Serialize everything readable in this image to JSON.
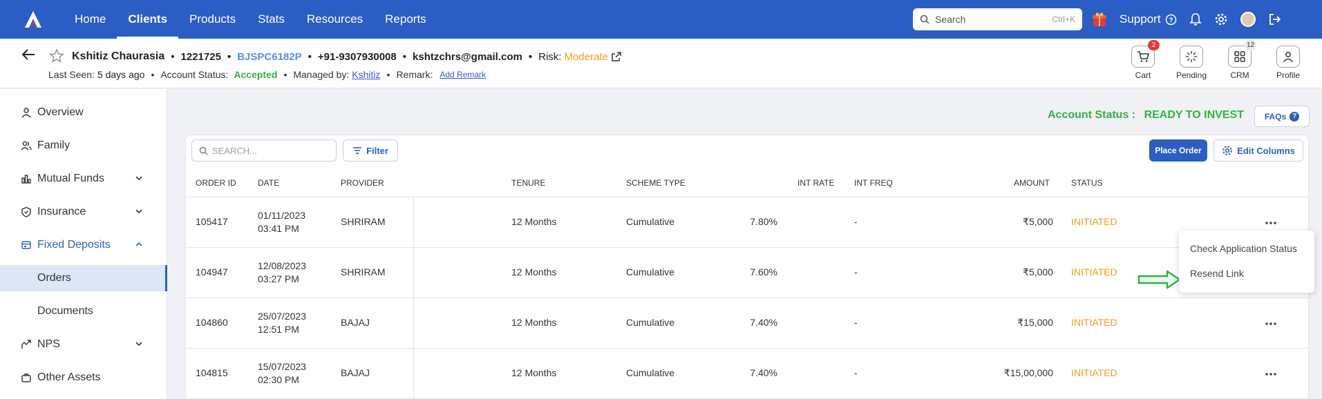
{
  "colors": {
    "brand": "#2a5ec4",
    "accent_green": "#2fb344",
    "warning_orange": "#f39c12",
    "badge_red": "#e53935"
  },
  "topnav": {
    "items": [
      "Home",
      "Clients",
      "Products",
      "Stats",
      "Resources",
      "Reports"
    ],
    "active": "Clients",
    "search_placeholder": "Search",
    "search_shortcut": "Ctrl+K",
    "support_label": "Support",
    "icons": [
      "gift-icon",
      "help-icon",
      "bell-icon",
      "gear-icon",
      "avatar",
      "logout-icon"
    ]
  },
  "client": {
    "name": "Kshitiz Chaurasia",
    "id": "1221725",
    "pan": "BJSPC6182P",
    "phone": "+91-9307930008",
    "email": "kshtzchrs@gmail.com",
    "risk_label": "Risk:",
    "risk_value": "Moderate",
    "last_seen_label": "Last Seen:",
    "last_seen_value": "5 days ago",
    "account_status_label": "Account Status:",
    "account_status_value": "Accepted",
    "managed_by_label": "Managed by:",
    "managed_by_value": "Kshitiz",
    "remark_label": "Remark:",
    "add_remark": "Add Remark"
  },
  "quick_actions": [
    {
      "label": "Cart",
      "badge": "2",
      "icon": "cart-icon"
    },
    {
      "label": "Pending",
      "badge": "",
      "icon": "spinner-icon"
    },
    {
      "label": "CRM",
      "badge": "12",
      "icon": "grid-icon"
    },
    {
      "label": "Profile",
      "badge": "",
      "icon": "user-icon"
    }
  ],
  "sidebar": {
    "items": [
      "Overview",
      "Family",
      "Mutual Funds",
      "Insurance",
      "Fixed Deposits",
      "Orders",
      "Documents",
      "NPS",
      "Other Assets"
    ],
    "active_parent": "Fixed Deposits",
    "active": "Orders"
  },
  "main": {
    "account_status_label": "Account Status :",
    "account_status_value": "READY TO INVEST",
    "faqs_label": "FAQs",
    "search_placeholder": "SEARCH...",
    "filter_label": "Filter",
    "place_order_label": "Place Order",
    "edit_columns_label": "Edit Columns"
  },
  "table": {
    "headers": [
      "ORDER ID",
      "DATE",
      "PROVIDER",
      "TENURE",
      "SCHEME TYPE",
      "INT RATE",
      "INT FREQ",
      "AMOUNT",
      "STATUS"
    ],
    "rows": [
      {
        "order_id": "105417",
        "date": "01/11/2023",
        "time": "03:41 PM",
        "provider": "SHRIRAM",
        "tenure": "12 Months",
        "scheme": "Cumulative",
        "rate": "7.80%",
        "freq": "-",
        "amount": "₹5,000",
        "status": "INITIATED"
      },
      {
        "order_id": "104947",
        "date": "12/08/2023",
        "time": "03:27 PM",
        "provider": "SHRIRAM",
        "tenure": "12 Months",
        "scheme": "Cumulative",
        "rate": "7.60%",
        "freq": "-",
        "amount": "₹5,000",
        "status": "INITIATED"
      },
      {
        "order_id": "104860",
        "date": "25/07/2023",
        "time": "12:51 PM",
        "provider": "BAJAJ",
        "tenure": "12 Months",
        "scheme": "Cumulative",
        "rate": "7.40%",
        "freq": "-",
        "amount": "₹15,000",
        "status": "INITIATED"
      },
      {
        "order_id": "104815",
        "date": "15/07/2023",
        "time": "02:30 PM",
        "provider": "BAJAJ",
        "tenure": "12 Months",
        "scheme": "Cumulative",
        "rate": "7.40%",
        "freq": "-",
        "amount": "₹15,00,000",
        "status": "INITIATED"
      }
    ]
  },
  "row_menu": {
    "items": [
      "Check Application Status",
      "Resend Link"
    ]
  }
}
